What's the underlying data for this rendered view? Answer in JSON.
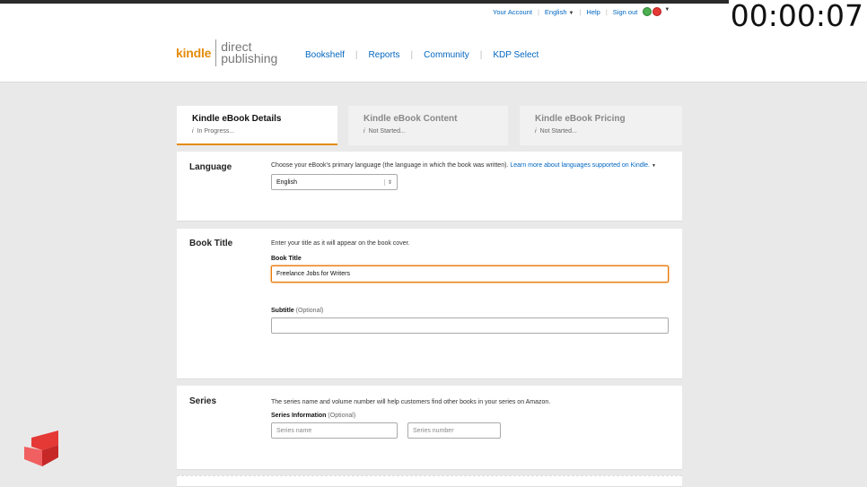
{
  "timer": "00:00:07",
  "utility": {
    "your_account": "Your Account",
    "language": "English",
    "help": "Help",
    "sign_out": "Sign out"
  },
  "logo": {
    "kindle": "kindle",
    "direct": "direct",
    "publishing": "publishing"
  },
  "nav": {
    "bookshelf": "Bookshelf",
    "reports": "Reports",
    "community": "Community",
    "kdp_select": "KDP Select"
  },
  "tabs": [
    {
      "title": "Kindle eBook Details",
      "status": "In Progress..."
    },
    {
      "title": "Kindle eBook Content",
      "status": "Not Started..."
    },
    {
      "title": "Kindle eBook Pricing",
      "status": "Not Started..."
    }
  ],
  "language": {
    "label": "Language",
    "desc": "Choose your eBook's primary language (the language in which the book was written).",
    "link": "Learn more about languages supported on Kindle.",
    "selected": "English"
  },
  "book_title": {
    "label": "Book Title",
    "desc": "Enter your title as it will appear on the book cover.",
    "field_label": "Book Title",
    "value": "Freelance Jobs for Writers",
    "subtitle_label": "Subtitle",
    "optional": "(Optional)",
    "subtitle_value": ""
  },
  "series": {
    "label": "Series",
    "desc": "The series name and volume number will help customers find other books in your series on Amazon.",
    "field_label": "Series Information",
    "optional": "(Optional)",
    "name_placeholder": "Series name",
    "number_placeholder": "Series number"
  },
  "colors": {
    "accent": "#e48c0c",
    "link": "#0066c0"
  }
}
